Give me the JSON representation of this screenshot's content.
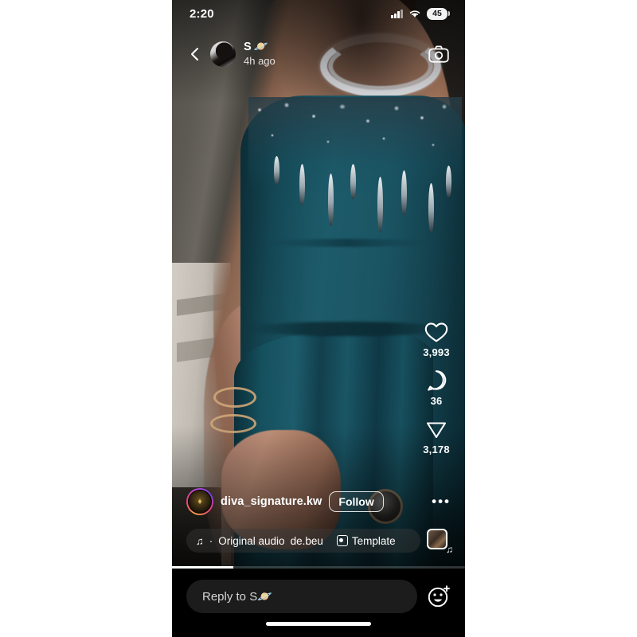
{
  "status_bar": {
    "time": "2:20",
    "battery_level": "45",
    "signal_icon": "cellular-signal-icon",
    "wifi_icon": "wifi-icon"
  },
  "story_header": {
    "back_icon": "back-chevron-icon",
    "avatar_name": "story-avatar",
    "username": "S",
    "username_emoji": "🪐",
    "timestamp": "4h ago",
    "camera_icon": "camera-icon"
  },
  "actions": [
    {
      "icon": "heart-icon",
      "name": "like-button",
      "count": "3,993"
    },
    {
      "icon": "comment-icon",
      "name": "comment-button",
      "count": "36"
    },
    {
      "icon": "share-icon",
      "name": "share-button",
      "count": "3,178"
    }
  ],
  "post": {
    "username": "diva_signature.kw",
    "follow_label": "Follow",
    "more_label": "•••",
    "audio_prefix": "·",
    "audio_label": "Original audio",
    "audio_author": "de.beu",
    "template_label": "Template",
    "music_note": "♫",
    "progress_percent": 21
  },
  "reply": {
    "placeholder": "Reply to S🪐",
    "sticker_icon": "sticker-smiley-icon"
  },
  "colors": {
    "dress_teal": "#1d5b6a",
    "frame_black": "#000000",
    "accent_white": "#ffffff",
    "input_gray": "#1c1c1c"
  }
}
